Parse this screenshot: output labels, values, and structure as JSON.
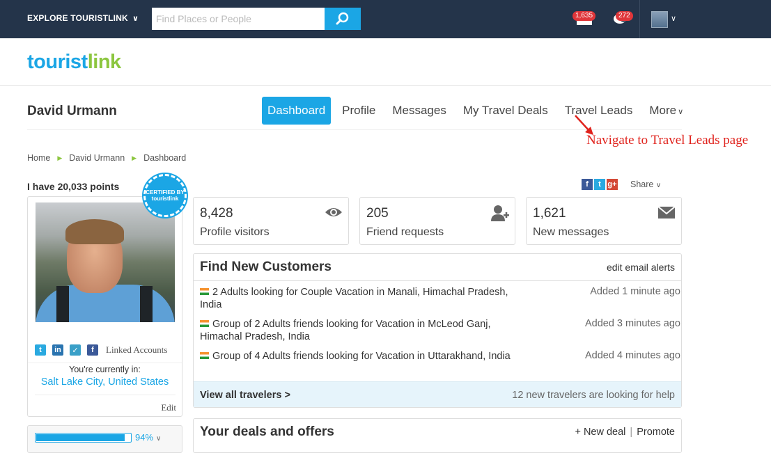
{
  "topbar": {
    "explore_label": "EXPLORE TOURISTLINK",
    "search_placeholder": "Find Places or People",
    "notif_count_1": "1,635",
    "notif_count_2": "272"
  },
  "logo": {
    "part1": "tourist",
    "part2": "link"
  },
  "header": {
    "username": "David Urmann"
  },
  "nav": {
    "items": [
      "Dashboard",
      "Profile",
      "Messages",
      "My Travel Deals",
      "Travel Leads",
      "More"
    ]
  },
  "annotation": "Navigate to Travel Leads page",
  "breadcrumb": [
    "Home",
    "David Urmann",
    "Dashboard"
  ],
  "profile": {
    "points": "I have 20,033 points",
    "seal_text": "CERTIFIED BY touristlink",
    "linked_accounts": "Linked Accounts",
    "current_label": "You're currently in:",
    "city": "Salt Lake City, United States",
    "edit": "Edit",
    "completion_pct": "94%",
    "completion": 0.94
  },
  "share": {
    "label": "Share"
  },
  "stats": [
    {
      "value": "8,428",
      "label": "Profile visitors",
      "icon": "eye-icon"
    },
    {
      "value": "205",
      "label": "Friend requests",
      "icon": "add-user-icon"
    },
    {
      "value": "1,621",
      "label": "New messages",
      "icon": "envelope-icon"
    }
  ],
  "customers": {
    "title": "Find New Customers",
    "edit_alerts": "edit email alerts",
    "leads": [
      {
        "text": "2 Adults looking for Couple Vacation in Manali, Himachal Pradesh, India",
        "time": "Added 1 minute ago"
      },
      {
        "text": "Group of 2 Adults friends looking for Vacation in McLeod Ganj, Himachal Pradesh, India",
        "time": "Added 3 minutes ago"
      },
      {
        "text": "Group of 4 Adults friends looking for Vacation in Uttarakhand, India",
        "time": "Added 4 minutes ago"
      }
    ],
    "view_all": "View all travelers >",
    "new_travelers": "12 new travelers are looking for help"
  },
  "deals": {
    "title": "Your deals and offers",
    "new_deal": "+ New deal",
    "sep": "|",
    "promote": "Promote"
  }
}
